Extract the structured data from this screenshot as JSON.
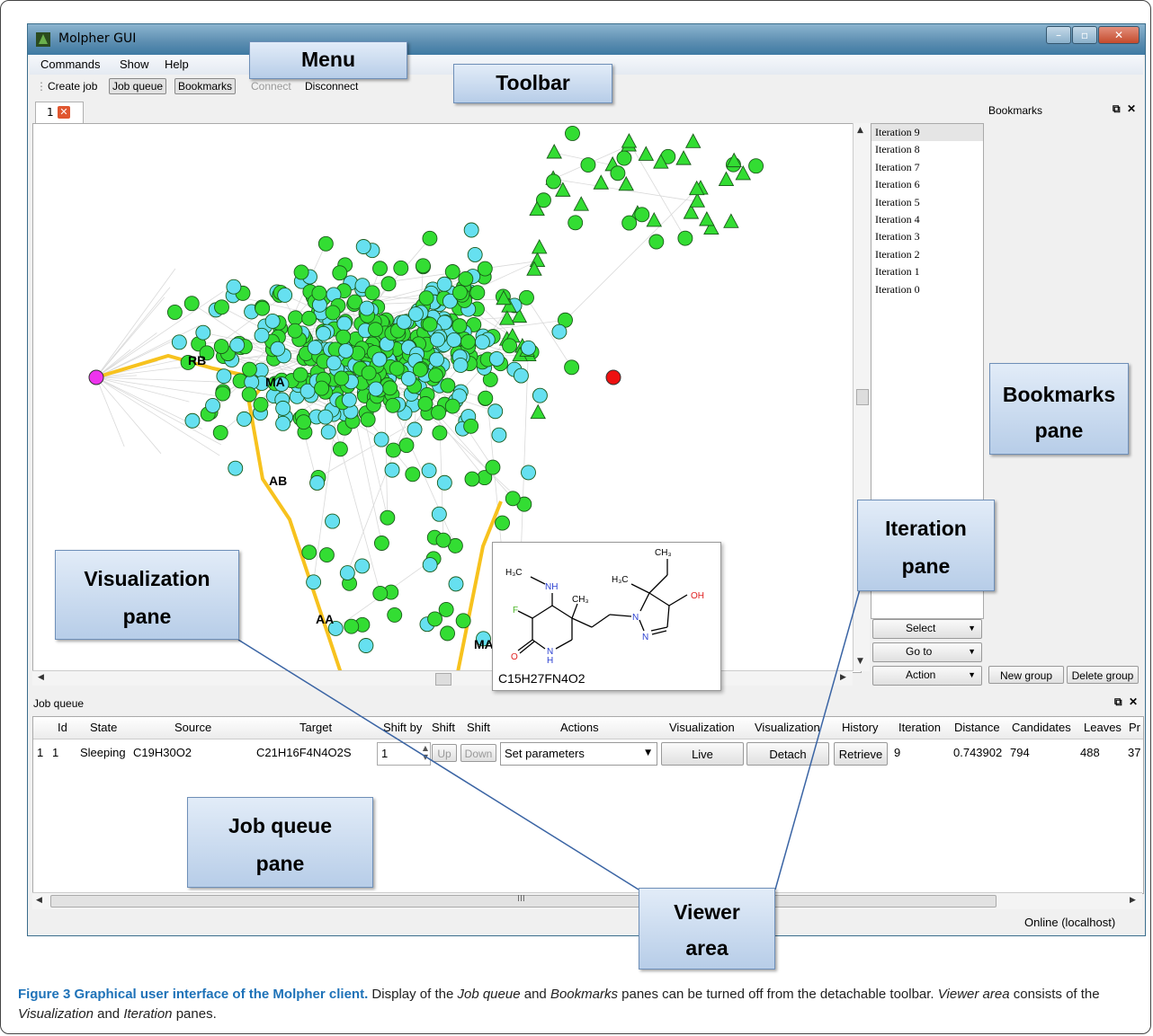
{
  "window": {
    "title": "Molpher GUI"
  },
  "menu": [
    "Commands",
    "Show",
    "Help"
  ],
  "toolbar": {
    "create_job": "Create job",
    "job_queue": "Job queue",
    "bookmarks": "Bookmarks",
    "connect": "Connect",
    "disconnect": "Disconnect"
  },
  "tab": {
    "label": "1"
  },
  "bookmarks_pane": {
    "title": "Bookmarks",
    "new_group": "New group",
    "delete_group": "Delete group"
  },
  "iterations": [
    "Iteration 9",
    "Iteration 8",
    "Iteration 7",
    "Iteration 6",
    "Iteration 5",
    "Iteration 4",
    "Iteration 3",
    "Iteration 2",
    "Iteration 1",
    "Iteration 0"
  ],
  "iteration_buttons": {
    "select": "Select",
    "goto": "Go to",
    "action": "Action"
  },
  "graph_labels": {
    "rb": "RB",
    "ma": "MA",
    "ab": "AB",
    "aa": "AA",
    "ma2": "MA"
  },
  "molecule_tooltip": {
    "formula": "C15H27FN4O2",
    "atoms": {
      "h3c1": "H₃C",
      "nh": "NH",
      "f": "F",
      "ch3a": "CH₃",
      "h3c2": "H₃C",
      "ch3b": "CH₃",
      "oh": "OH",
      "n1": "N",
      "n2": "N",
      "o": "O",
      "nh2": "N",
      "h": "H"
    }
  },
  "job_queue": {
    "title": "Job queue",
    "columns": [
      "Id",
      "State",
      "Source",
      "Target",
      "Shift by",
      "Shift",
      "Shift",
      "Actions",
      "Visualization",
      "Visualization",
      "History",
      "Iteration",
      "Distance",
      "Candidates",
      "Leaves",
      "Pr"
    ],
    "rows": [
      {
        "row_num": "1",
        "id": "1",
        "state": "Sleeping",
        "source": "C19H30O2",
        "target": "C21H16F4N4O2S",
        "shift_by": "1",
        "up": "Up",
        "down": "Down",
        "actions": "Set parameters",
        "vis_live": "Live",
        "vis_detach": "Detach",
        "history": "Retrieve",
        "iteration": "9",
        "distance": "0.743902",
        "candidates": "794",
        "leaves": "488",
        "pr": "37"
      }
    ],
    "hscroll_grip": "III"
  },
  "status": {
    "text": "Online (localhost)"
  },
  "callouts": {
    "menu": "Menu",
    "toolbar": "Toolbar",
    "bookmarks": [
      "Bookmarks",
      "pane"
    ],
    "iteration": [
      "Iteration",
      "pane"
    ],
    "visualization": [
      "Visualization",
      "pane"
    ],
    "job_queue": [
      "Job queue",
      "pane"
    ],
    "viewer": [
      "Viewer",
      "area"
    ]
  },
  "caption": {
    "bold": "Figure 3 Graphical user interface of the Molpher client.",
    "t1": " Display of the ",
    "i1": "Job queue",
    "t2": " and ",
    "i2": "Bookmarks",
    "t3": " panes can be turned off from the detachable toolbar. ",
    "i3": "Viewer area",
    "t4": " consists of the ",
    "i4": "Visualization",
    "t5": " and ",
    "i5": "Iteration",
    "t6": " panes."
  },
  "colors": {
    "cyan_node": "#66e0f0",
    "green_node": "#33dd33",
    "path": "#f7c21e",
    "source_node": "#ee33ee",
    "target_node": "#ee1111"
  }
}
